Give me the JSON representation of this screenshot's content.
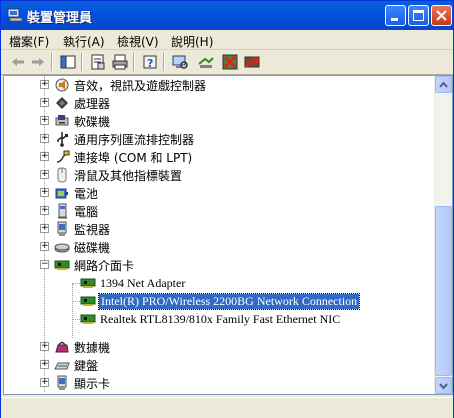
{
  "window": {
    "title": "裝置管理員",
    "accent": "#0451e3"
  },
  "menu": {
    "items": [
      "檔案(F)",
      "執行(A)",
      "檢視(V)",
      "說明(H)"
    ]
  },
  "toolbar": {
    "icons": [
      "back-arrow-icon",
      "forward-arrow-icon",
      "console-tree-icon",
      "properties-icon",
      "print-icon",
      "help-icon",
      "scan-hardware-icon",
      "update-driver-icon",
      "uninstall-icon",
      "disable-icon"
    ]
  },
  "tree": {
    "categories": [
      {
        "label": "音效，視訊及遊戲控制器",
        "icon": "sound-icon",
        "expanded": false
      },
      {
        "label": "處理器",
        "icon": "processor-icon",
        "expanded": false
      },
      {
        "label": "軟碟機",
        "icon": "floppy-drive-icon",
        "expanded": false
      },
      {
        "label": "通用序列匯流排控制器",
        "icon": "usb-icon",
        "expanded": false
      },
      {
        "label": "連接埠 (COM 和 LPT)",
        "icon": "port-icon",
        "expanded": false
      },
      {
        "label": "滑鼠及其他指標裝置",
        "icon": "mouse-icon",
        "expanded": false
      },
      {
        "label": "電池",
        "icon": "battery-icon",
        "expanded": false
      },
      {
        "label": "電腦",
        "icon": "computer-icon",
        "expanded": false
      },
      {
        "label": "監視器",
        "icon": "monitor-icon",
        "expanded": false
      },
      {
        "label": "磁碟機",
        "icon": "disk-drive-icon",
        "expanded": false
      },
      {
        "label": "網路介面卡",
        "icon": "network-adapter-icon",
        "expanded": true,
        "children": [
          {
            "label": "1394 Net Adapter",
            "selected": false
          },
          {
            "label": "Intel(R) PRO/Wireless 2200BG Network Connection",
            "selected": true
          },
          {
            "label": "Realtek RTL8139/810x Family Fast Ethernet NIC",
            "selected": false
          }
        ]
      },
      {
        "label": "數據機",
        "icon": "modem-icon",
        "expanded": false
      },
      {
        "label": "鍵盤",
        "icon": "keyboard-icon",
        "expanded": false
      },
      {
        "label": "顯示卡",
        "icon": "display-adapter-icon",
        "expanded": false
      }
    ]
  },
  "colors": {
    "selection": "#316ac5"
  }
}
